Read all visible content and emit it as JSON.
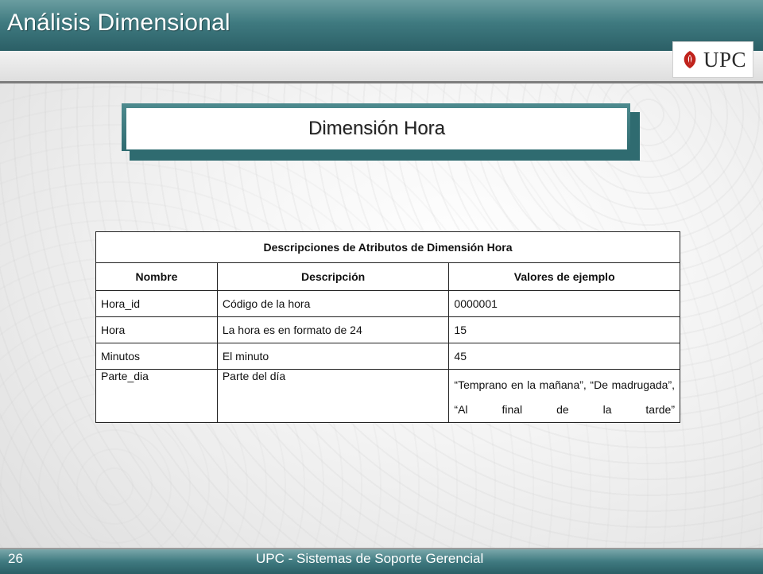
{
  "slide": {
    "title": "Análisis Dimensional",
    "logo_text": "UPC",
    "section_title": "Dimensión Hora",
    "page_number": "26",
    "footer": "UPC - Sistemas de Soporte Gerencial"
  },
  "colors": {
    "header_teal": "#3f7a80",
    "header_text": "#ffffff",
    "logo_red": "#c0231c"
  },
  "table": {
    "caption": "Descripciones de Atributos de Dimensión Hora",
    "headers": [
      "Nombre",
      "Descripción",
      "Valores de ejemplo"
    ],
    "rows": [
      {
        "nombre": "Hora_id",
        "descripcion": "Código de la hora",
        "valores": "0000001"
      },
      {
        "nombre": "Hora",
        "descripcion": "La hora es en formato de 24",
        "valores": "15"
      },
      {
        "nombre": "Minutos",
        "descripcion": "El minuto",
        "valores": "45"
      },
      {
        "nombre": "Parte_dia",
        "descripcion": "Parte del día",
        "valores": "“Temprano en la mañana”, “De madrugada”, “Al final de la tarde”"
      }
    ]
  }
}
